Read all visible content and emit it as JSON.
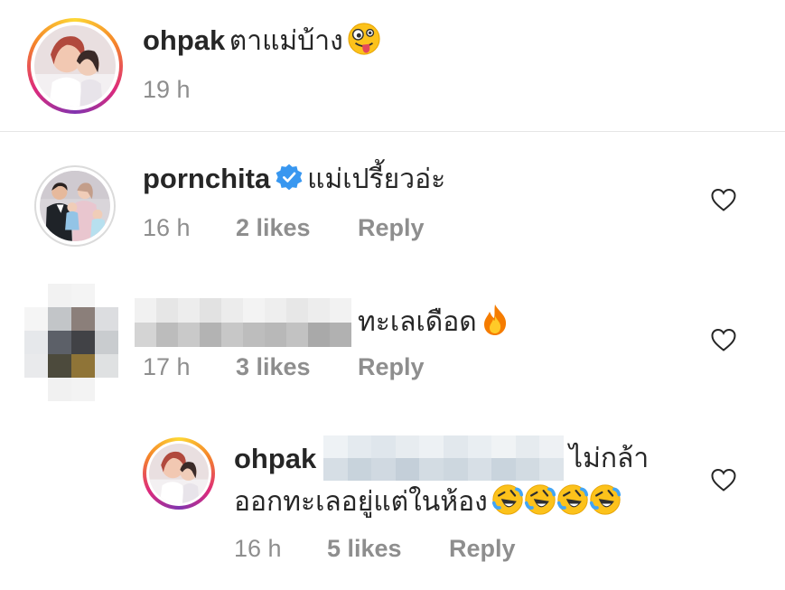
{
  "comments": [
    {
      "username": "ohpak",
      "text": "ตาแม่บ้าง",
      "emoji": "zany-face",
      "time": "19 h"
    },
    {
      "username": "pornchita",
      "verified": true,
      "text": "แม่เปรี้ยวอ่ะ",
      "time": "16 h",
      "likes": "2 likes",
      "reply": "Reply"
    },
    {
      "username_obscured": true,
      "text": "ทะเลเดือด",
      "emoji": "fire",
      "time": "17 h",
      "likes": "3 likes",
      "reply": "Reply"
    },
    {
      "username": "ohpak",
      "mention_obscured": true,
      "text_line1": "ไม่กล้า",
      "text_line2": "ออกทะเลอยู่แต่ในห้อง",
      "emoji": "rolling-on-floor-laughing",
      "emoji_count": 4,
      "time": "16 h",
      "likes": "5 likes",
      "reply": "Reply"
    }
  ],
  "colors": {
    "text": "#262626",
    "meta": "#8e8e8e",
    "verified": "#3897f0",
    "divider": "#e6e6e6"
  }
}
